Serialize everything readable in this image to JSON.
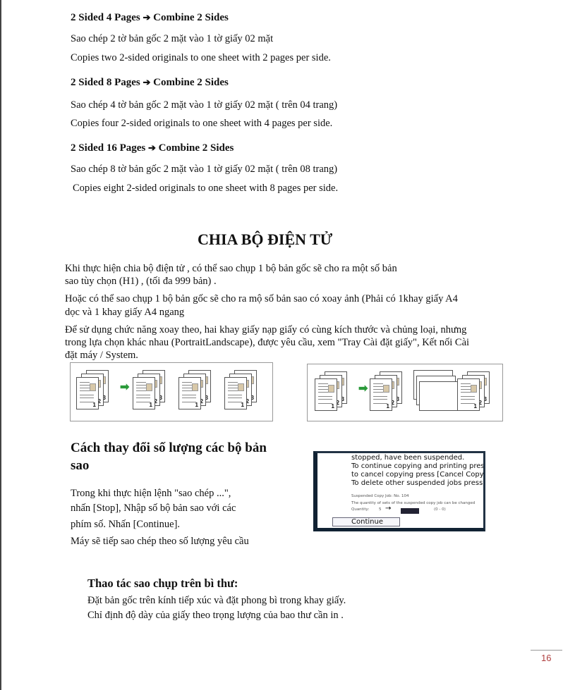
{
  "sections": [
    {
      "heading": "2 Sided 4 Pages",
      "arrow": "➔",
      "heading_tail": "Combine 2 Sides",
      "vi": "Sao chép 2 tờ bản gốc 2 mặt vào 1 tờ giấy 02 mặt",
      "en": "Copies two 2-sided originals to one sheet with 2 pages per side."
    },
    {
      "heading": "2 Sided 8 Pages",
      "arrow": "➔",
      "heading_tail": "Combine 2 Sides",
      "vi": "Sao chép 4 tờ bản gốc 2 mặt vào 1 tờ giấy 02 mặt ( trên 04 trang)",
      "en": "Copies four 2-sided originals to one sheet with 4 pages per side."
    },
    {
      "heading": "2 Sided 16 Pages",
      "arrow": "➔",
      "heading_tail": "Combine 2 Sides",
      "vi": "Sao chép 8 tờ bản gốc 2 mặt vào 1 tờ giấy 02 mặt ( trên 08 trang)",
      "en": "Copies eight 2-sided originals to one sheet with 8 pages per side."
    }
  ],
  "sort": {
    "title": "CHIA BỘ ĐIỆN TỬ",
    "p1a": "Khi thực hiện chia bộ điện tử , có thể sao chụp 1 bộ bản gốc sẽ cho ra một số bản",
    "p1b": "sao tùy chọn (H1) , (tối đa 999 bản) .",
    "p2a": "Hoặc có thể sao chụp 1 bộ bản gốc sẽ cho ra mộ số bản sao có xoay ảnh (Phải có 1khay giấy A4",
    "p2b": "dọc và 1 khay giấy A4 ngang",
    "p3a": "Để sử dụng chức năng xoay theo, hai khay giấy nạp giấy có cùng kích thước và chủng loại, nhưng",
    "p3b": "trong  lựa chọn khác nhau (PortraitLandscape), được yêu cầu, xem \"Tray Cài đặt giấy\", Kết nối Cài",
    "p3c": "đặt máy / System."
  },
  "figures": {
    "page_numbers": [
      "1",
      "2",
      "3"
    ],
    "arrow_color": "#2a9a3a"
  },
  "change": {
    "heading": "Cách thay đổi số lượng các bộ bản sao",
    "p1a": "Trong khi thực hiện lệnh \"sao chép ...\",",
    "p1b": "nhấn [Stop], Nhập số bộ bản sao với các",
    "p1c": "phím số. Nhấn [Continue].",
    "p2": "Máy sẽ tiếp sao chép theo số lượng yêu cầu"
  },
  "screen": {
    "line1": "stopped, have been suspended.",
    "line2": "To continue copying and printing press",
    "line3": "to cancel copying press [Cancel Copy",
    "line4": "To delete other suspended jobs press",
    "job": "Suspended Copy Job:   No. 104",
    "note": "The quantity of sets of the suspended copy job can be changed",
    "qty_label": "Quantity:",
    "qty_value": "5",
    "qty_arrow": "→",
    "range": "(0 - 0)",
    "continue": "Continue"
  },
  "envelope": {
    "heading": "Thao tác sao chụp  trên bì thư:",
    "l1": "Đặt bản gốc trên kính tiếp xúc và đặt phong bì trong  khay giấy.",
    "l2": "Chỉ định độ dày của giấy theo trọng lượng của bao thư cần in ."
  },
  "page_number": "16"
}
